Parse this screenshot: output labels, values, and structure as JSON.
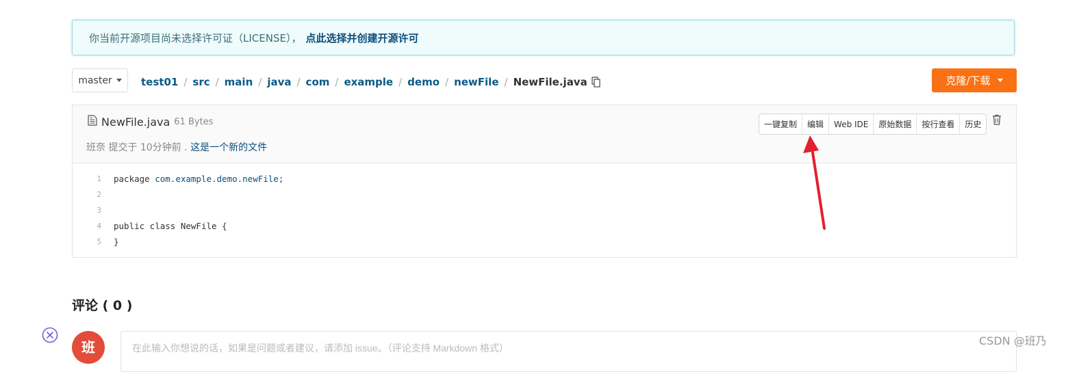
{
  "notice": {
    "text": "你当前开源项目尚未选择许可证（LICENSE），",
    "link": "点此选择并创建开源许可"
  },
  "branch": {
    "label": "master"
  },
  "breadcrumb": {
    "items": [
      "test01",
      "src",
      "main",
      "java",
      "com",
      "example",
      "demo",
      "newFile"
    ],
    "current": "NewFile.java",
    "separator": "/"
  },
  "clone_button": {
    "label": "克隆/下载"
  },
  "file": {
    "name": "NewFile.java",
    "size": "61 Bytes",
    "commit_author_time": "班奈 提交于 10分钟前 .",
    "commit_message": "这是一个新的文件",
    "actions": [
      "一键复制",
      "编辑",
      "Web IDE",
      "原始数据",
      "按行查看",
      "历史"
    ],
    "code_lines": [
      {
        "num": "1",
        "kw": "package ",
        "rest": "com.example.demo.newFile;"
      },
      {
        "num": "2",
        "kw": "",
        "rest": ""
      },
      {
        "num": "3",
        "kw": "",
        "rest": ""
      },
      {
        "num": "4",
        "kw": "public class ",
        "rest": "NewFile {"
      },
      {
        "num": "5",
        "kw": "",
        "rest": "}"
      }
    ]
  },
  "comments": {
    "title": "评论 ( 0 )",
    "avatar_text": "班",
    "placeholder": "在此输入你想说的话，如果是问题或者建议，请添加 issue。（评论支持 Markdown 格式）"
  },
  "watermark": "CSDN @班乃",
  "colors": {
    "accent": "#fa7114",
    "link": "#0b5a87",
    "annotation_arrow": "#e3202e"
  }
}
